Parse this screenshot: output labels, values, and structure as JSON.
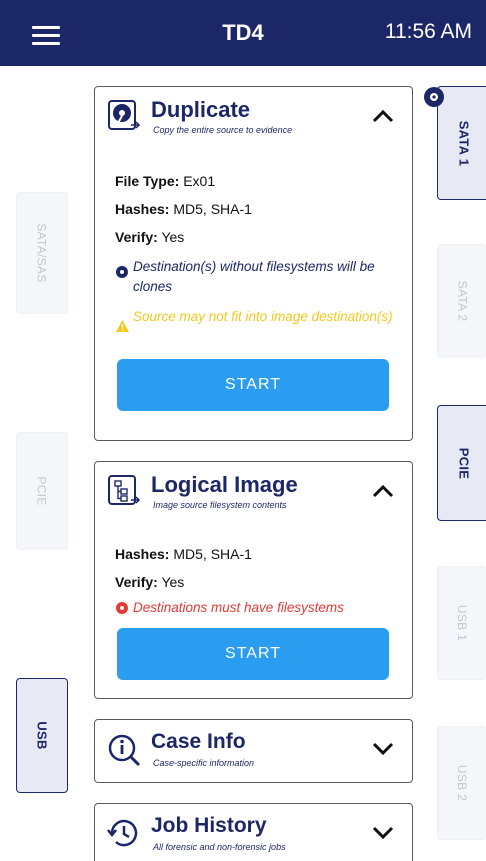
{
  "header": {
    "title": "TD4",
    "time": "11:56 AM"
  },
  "left_tabs": [
    {
      "label": "SATA/SAS"
    },
    {
      "label": "PCIE"
    },
    {
      "label": "USB"
    }
  ],
  "right_tabs": [
    {
      "label": "SATA 1"
    },
    {
      "label": "SATA 2"
    },
    {
      "label": "PCIE"
    },
    {
      "label": "USB 1"
    },
    {
      "label": "USB 2"
    }
  ],
  "duplicate": {
    "title": "Duplicate",
    "subtitle": "Copy the entire source to evidence",
    "file_type_label": "File Type:",
    "file_type_value": " Ex01",
    "hashes_label": "Hashes:",
    "hashes_value": " MD5, SHA-1",
    "verify_label": "Verify:",
    "verify_value": " Yes",
    "info_message": "Destination(s) without filesystems will be clones",
    "warning_message": "Source may not fit into image destination(s)",
    "start_label": "START"
  },
  "logical_image": {
    "title": "Logical Image",
    "subtitle": "Image source filesystem contents",
    "hashes_label": "Hashes:",
    "hashes_value": " MD5, SHA-1",
    "verify_label": "Verify:",
    "verify_value": " Yes",
    "error_message": "Destinations must have filesystems",
    "start_label": "START"
  },
  "case_info": {
    "title": "Case Info",
    "subtitle": "Case-specific information"
  },
  "job_history": {
    "title": "Job History",
    "subtitle": "All forensic and non-forensic jobs"
  },
  "colors": {
    "header_bg": "#1c2767",
    "accent_blue": "#2b9df0",
    "warning": "#f4c81f",
    "error": "#e53935"
  },
  "icons": [
    "menu-icon",
    "disk-icon",
    "tree-icon",
    "info-icon",
    "history-icon",
    "chevron-up-icon",
    "chevron-down-icon",
    "drive-badge-icon",
    "warning-icon",
    "error-icon"
  ]
}
